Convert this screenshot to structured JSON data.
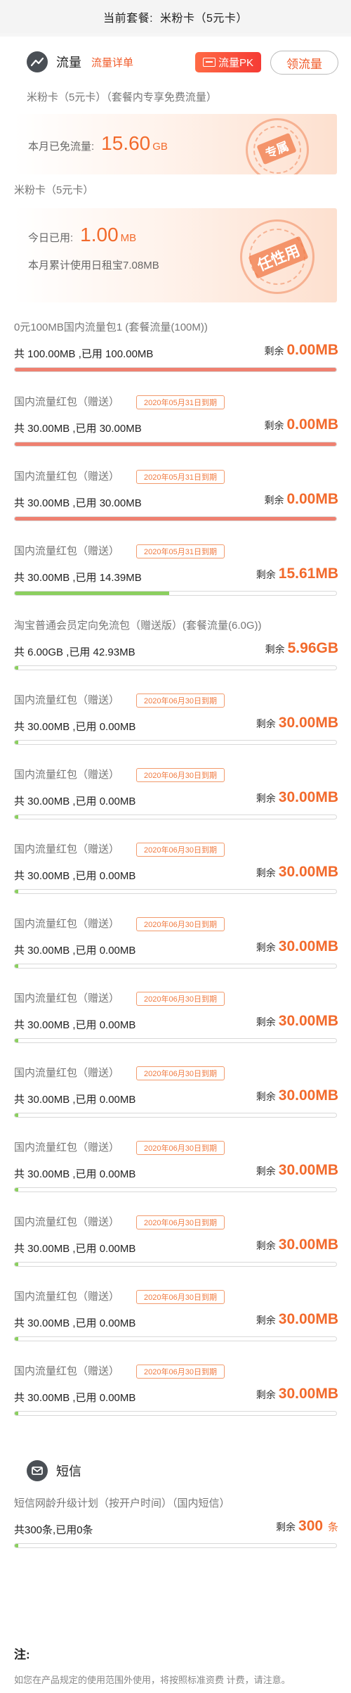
{
  "header": {
    "label": "当前套餐:",
    "plan_name": "米粉卡（5元卡）"
  },
  "traffic_section": {
    "title": "流量",
    "detail_link": "流量详单",
    "pk_button": "流量PK",
    "claim_button": "领流量",
    "icon": "trend-icon"
  },
  "exclusive": {
    "subtitle": "米粉卡（5元卡）（套餐内专享免费流量）",
    "label": "本月已免流量:",
    "value": "15.60",
    "unit": "GB",
    "stamp": "专属"
  },
  "daily": {
    "subtitle": "米粉卡（5元卡）",
    "today_label": "今日已用:",
    "today_value": "1.00",
    "today_unit": "MB",
    "month_line": "本月累计使用日租宝7.08MB",
    "stamp": "任性用"
  },
  "colors": {
    "accent": "#f26a2c",
    "red_fill": "#ef8070",
    "green_fill": "#8bcf5e"
  },
  "plans": [
    {
      "title": "0元100MB国内流量包1 (套餐流量(100M))",
      "expire": "",
      "usage": "共 100.00MB ,已用 100.00MB",
      "remain_label": "剩余",
      "remain": "0.00MB",
      "used_fraction": 1.0,
      "fill": "red"
    },
    {
      "title": "国内流量红包（赠送）",
      "expire": "2020年05月31日到期",
      "usage": "共 30.00MB ,已用 30.00MB",
      "remain_label": "剩余",
      "remain": "0.00MB",
      "used_fraction": 1.0,
      "fill": "red"
    },
    {
      "title": "国内流量红包（赠送）",
      "expire": "2020年05月31日到期",
      "usage": "共 30.00MB ,已用 30.00MB",
      "remain_label": "剩余",
      "remain": "0.00MB",
      "used_fraction": 1.0,
      "fill": "red"
    },
    {
      "title": "国内流量红包（赠送）",
      "expire": "2020年05月31日到期",
      "usage": "共 30.00MB ,已用 14.39MB",
      "remain_label": "剩余",
      "remain": "15.61MB",
      "used_fraction": 0.48,
      "fill": "green"
    },
    {
      "title": "淘宝普通会员定向免流包（赠送版）(套餐流量(6.0G))",
      "expire": "",
      "usage": "共 6.00GB ,已用 42.93MB",
      "remain_label": "剩余",
      "remain": "5.96GB",
      "used_fraction": 0.007,
      "fill": "green"
    },
    {
      "title": "国内流量红包（赠送）",
      "expire": "2020年06月30日到期",
      "usage": "共 30.00MB ,已用 0.00MB",
      "remain_label": "剩余",
      "remain": "30.00MB",
      "used_fraction": 0.0,
      "fill": "green"
    },
    {
      "title": "国内流量红包（赠送）",
      "expire": "2020年06月30日到期",
      "usage": "共 30.00MB ,已用 0.00MB",
      "remain_label": "剩余",
      "remain": "30.00MB",
      "used_fraction": 0.0,
      "fill": "green"
    },
    {
      "title": "国内流量红包（赠送）",
      "expire": "2020年06月30日到期",
      "usage": "共 30.00MB ,已用 0.00MB",
      "remain_label": "剩余",
      "remain": "30.00MB",
      "used_fraction": 0.0,
      "fill": "green"
    },
    {
      "title": "国内流量红包（赠送）",
      "expire": "2020年06月30日到期",
      "usage": "共 30.00MB ,已用 0.00MB",
      "remain_label": "剩余",
      "remain": "30.00MB",
      "used_fraction": 0.0,
      "fill": "green"
    },
    {
      "title": "国内流量红包（赠送）",
      "expire": "2020年06月30日到期",
      "usage": "共 30.00MB ,已用 0.00MB",
      "remain_label": "剩余",
      "remain": "30.00MB",
      "used_fraction": 0.0,
      "fill": "green"
    },
    {
      "title": "国内流量红包（赠送）",
      "expire": "2020年06月30日到期",
      "usage": "共 30.00MB ,已用 0.00MB",
      "remain_label": "剩余",
      "remain": "30.00MB",
      "used_fraction": 0.0,
      "fill": "green"
    },
    {
      "title": "国内流量红包（赠送）",
      "expire": "2020年06月30日到期",
      "usage": "共 30.00MB ,已用 0.00MB",
      "remain_label": "剩余",
      "remain": "30.00MB",
      "used_fraction": 0.0,
      "fill": "green"
    },
    {
      "title": "国内流量红包（赠送）",
      "expire": "2020年06月30日到期",
      "usage": "共 30.00MB ,已用 0.00MB",
      "remain_label": "剩余",
      "remain": "30.00MB",
      "used_fraction": 0.0,
      "fill": "green"
    },
    {
      "title": "国内流量红包（赠送）",
      "expire": "2020年06月30日到期",
      "usage": "共 30.00MB ,已用 0.00MB",
      "remain_label": "剩余",
      "remain": "30.00MB",
      "used_fraction": 0.0,
      "fill": "green"
    },
    {
      "title": "国内流量红包（赠送）",
      "expire": "2020年06月30日到期",
      "usage": "共 30.00MB ,已用 0.00MB",
      "remain_label": "剩余",
      "remain": "30.00MB",
      "used_fraction": 0.0,
      "fill": "green"
    }
  ],
  "sms_section": {
    "title": "短信",
    "icon": "mail-icon",
    "plan_title": "短信网龄升级计划（按开户时间）（国内短信）",
    "usage": "共300条,已用0条",
    "remain_label": "剩余",
    "remain_value": "300",
    "remain_unit": "条",
    "used_fraction": 0.0
  },
  "footer": {
    "note_title": "注:",
    "note_text": "如您在产品规定的使用范围外使用，将按照标准资费 计费，请注意。"
  }
}
